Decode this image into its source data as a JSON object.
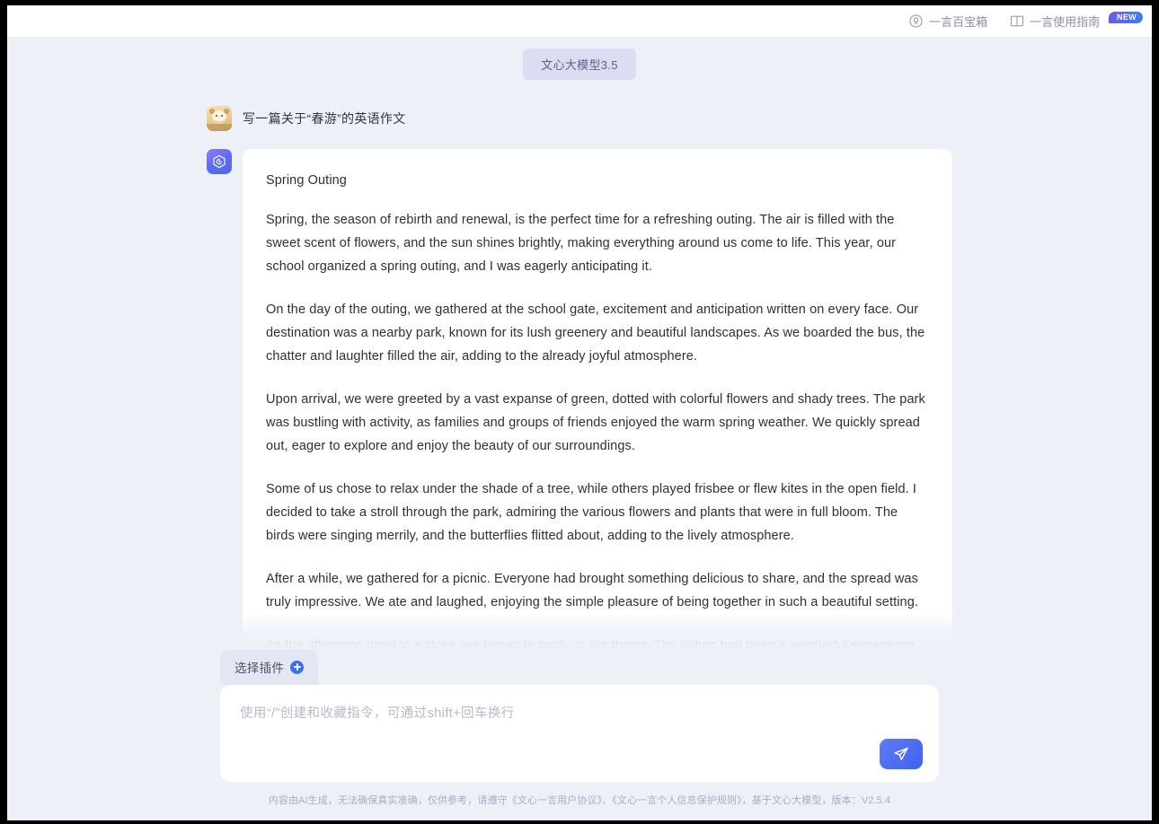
{
  "topbar": {
    "links": [
      {
        "label": "一言百宝箱",
        "icon": "lightbulb-icon",
        "badge": null
      },
      {
        "label": "一言使用指南",
        "icon": "book-icon",
        "badge": "NEW"
      }
    ]
  },
  "model": {
    "pill_label": "文心大模型3.5"
  },
  "conversation": {
    "user": {
      "avatar_name": "user-avatar",
      "message": "写一篇关于“春游”的英语作文"
    },
    "assistant": {
      "avatar_name": "ernie-bot-avatar",
      "title": "Spring Outing",
      "paragraphs": [
        "Spring, the season of rebirth and renewal, is the perfect time for a refreshing outing. The air is filled with the sweet scent of flowers, and the sun shines brightly, making everything around us come to life. This year, our school organized a spring outing, and I was eagerly anticipating it.",
        "On the day of the outing, we gathered at the school gate, excitement and anticipation written on every face. Our destination was a nearby park, known for its lush greenery and beautiful landscapes. As we boarded the bus, the chatter and laughter filled the air, adding to the already joyful atmosphere.",
        "Upon arrival, we were greeted by a vast expanse of green, dotted with colorful flowers and shady trees. The park was bustling with activity, as families and groups of friends enjoyed the warm spring weather. We quickly spread out, eager to explore and enjoy the beauty of our surroundings.",
        "Some of us chose to relax under the shade of a tree, while others played frisbee or flew kites in the open field. I decided to take a stroll through the park, admiring the various flowers and plants that were in full bloom. The birds were singing merrily, and the butterflies flitted about, adding to the lively atmosphere.",
        "After a while, we gathered for a picnic. Everyone had brought something delicious to share, and the spread was truly impressive. We ate and laughed, enjoying the simple pleasure of being together in such a beautiful setting.",
        "As the afternoon drew to a close, we began to pack up our things. The outing had been a wonderful experience, and I was already looking forward to the next one. As we boarded the bus back to school, I couldn't help but"
      ]
    }
  },
  "composer": {
    "plugin_label": "选择插件",
    "plugin_icon": "plus-circle-icon",
    "input_value": "",
    "input_placeholder": "使用“/”创建和收藏指令，可通过shift+回车换行",
    "send_icon": "paper-plane-icon"
  },
  "footer": {
    "text": "内容由AI生成，无法确保真实准确，仅供参考，请遵守《文心一言用户协议》、《文心一言个人信息保护规则》，基于文心大模型，版本：V2.5.4"
  },
  "colors": {
    "accent": "#3f62ef",
    "page_bg": "#eef0f8",
    "card_bg": "#ffffff",
    "pill_bg": "#dcdcf3",
    "pill_text": "#5e5f85",
    "muted_text": "#a9adc4"
  }
}
